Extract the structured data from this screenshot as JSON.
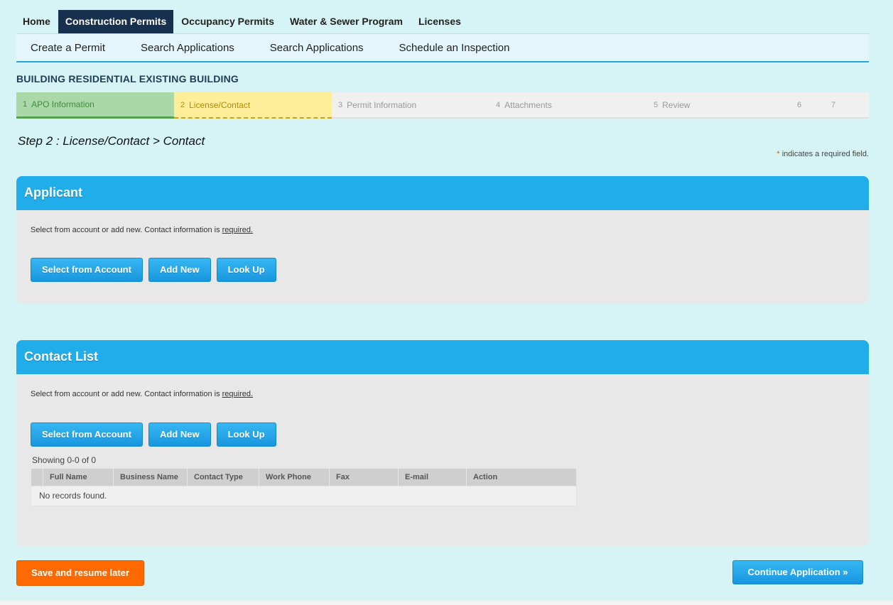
{
  "topnav": {
    "items": [
      {
        "label": "Home"
      },
      {
        "label": "Construction Permits"
      },
      {
        "label": "Occupancy Permits"
      },
      {
        "label": "Water & Sewer Program"
      },
      {
        "label": "Licenses"
      }
    ],
    "active_index": 1
  },
  "subnav": {
    "items": [
      {
        "label": "Create a Permit"
      },
      {
        "label": "Search Applications"
      },
      {
        "label": "Search Applications"
      },
      {
        "label": "Schedule an Inspection"
      }
    ]
  },
  "page_title": "BUILDING RESIDENTIAL EXISTING BUILDING",
  "stepper": {
    "steps": [
      {
        "num": "1",
        "label": "APO Information",
        "state": "done"
      },
      {
        "num": "2",
        "label": "License/Contact",
        "state": "current"
      },
      {
        "num": "3",
        "label": "Permit Information",
        "state": "todo"
      },
      {
        "num": "4",
        "label": "Attachments",
        "state": "todo"
      },
      {
        "num": "5",
        "label": "Review",
        "state": "todo"
      },
      {
        "num": "6",
        "label": "",
        "state": "todo"
      },
      {
        "num": "7",
        "label": "",
        "state": "todo"
      }
    ]
  },
  "step_heading": "Step 2 : License/Contact > Contact",
  "required_note": {
    "star": "*",
    "text": " indicates a required field."
  },
  "applicant": {
    "title": "Applicant",
    "desc_prefix": "Select from account or add new. Contact information is ",
    "desc_required": "required.",
    "buttons": {
      "select": "Select from Account",
      "add": "Add New",
      "lookup": "Look Up"
    }
  },
  "contact_list": {
    "title": "Contact List",
    "desc_prefix": "Select from account or add new. Contact information is ",
    "desc_required": "required.",
    "buttons": {
      "select": "Select from Account",
      "add": "Add New",
      "lookup": "Look Up"
    },
    "showing": "Showing 0-0 of 0",
    "columns": [
      "Full Name",
      "Business Name",
      "Contact Type",
      "Work Phone",
      "Fax",
      "E-mail",
      "Action"
    ],
    "empty_text": "No records found."
  },
  "actions": {
    "save_label": "Save and resume later",
    "continue_label": "Continue Application »"
  },
  "colors": {
    "background": "#d6f4f5",
    "nav_active": "#17304d",
    "panel_header": "#21adea",
    "save_button": "#ff6a00",
    "step_done": "#aad8a8",
    "step_current": "#ffee99"
  }
}
